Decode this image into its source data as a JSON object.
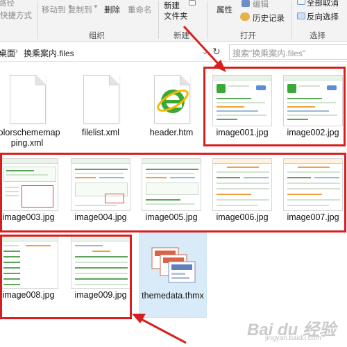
{
  "ribbon": {
    "clipboard_lines": [
      "路径",
      "快捷方式"
    ],
    "move_to": "移动到",
    "copy_to": "复制到",
    "delete": "删除",
    "rename": "重命名",
    "new_folder": "新建\n文件夹",
    "properties": "属性",
    "edit": "编辑",
    "history": "历史记录",
    "select_all": "全部取消",
    "invert": "反向选择",
    "groups": {
      "organize": "组织",
      "new": "新建",
      "open": "打开",
      "select": "选择"
    }
  },
  "address": {
    "crumb_prev": "桌面",
    "crumb_current": "换乘案内.files",
    "search_placeholder": "搜索\"换乘案内.files\""
  },
  "files": [
    {
      "name": "colorschememapping.xml",
      "type": "xml"
    },
    {
      "name": "filelist.xml",
      "type": "xml"
    },
    {
      "name": "header.htm",
      "type": "htm"
    },
    {
      "name": "image001.jpg",
      "type": "jpg"
    },
    {
      "name": "image002.jpg",
      "type": "jpg"
    },
    {
      "name": "image003.jpg",
      "type": "jpg"
    },
    {
      "name": "image004.jpg",
      "type": "jpg"
    },
    {
      "name": "image005.jpg",
      "type": "jpg"
    },
    {
      "name": "image006.jpg",
      "type": "jpg"
    },
    {
      "name": "image007.jpg",
      "type": "jpg"
    },
    {
      "name": "image008.jpg",
      "type": "jpg"
    },
    {
      "name": "image009.jpg",
      "type": "jpg"
    },
    {
      "name": "themedata.thmx",
      "type": "thmx",
      "selected": true
    }
  ],
  "colors": {
    "annotation": "#d81f1f",
    "selection": "#d9ebf9",
    "ie_green": "#3aa935"
  },
  "icons": [
    "refresh-icon",
    "chevron-icon",
    "ie-logo-icon",
    "theme-icon"
  ],
  "watermark": {
    "text": "Bai du 经验",
    "sub": "jingyan.baidu.com"
  }
}
